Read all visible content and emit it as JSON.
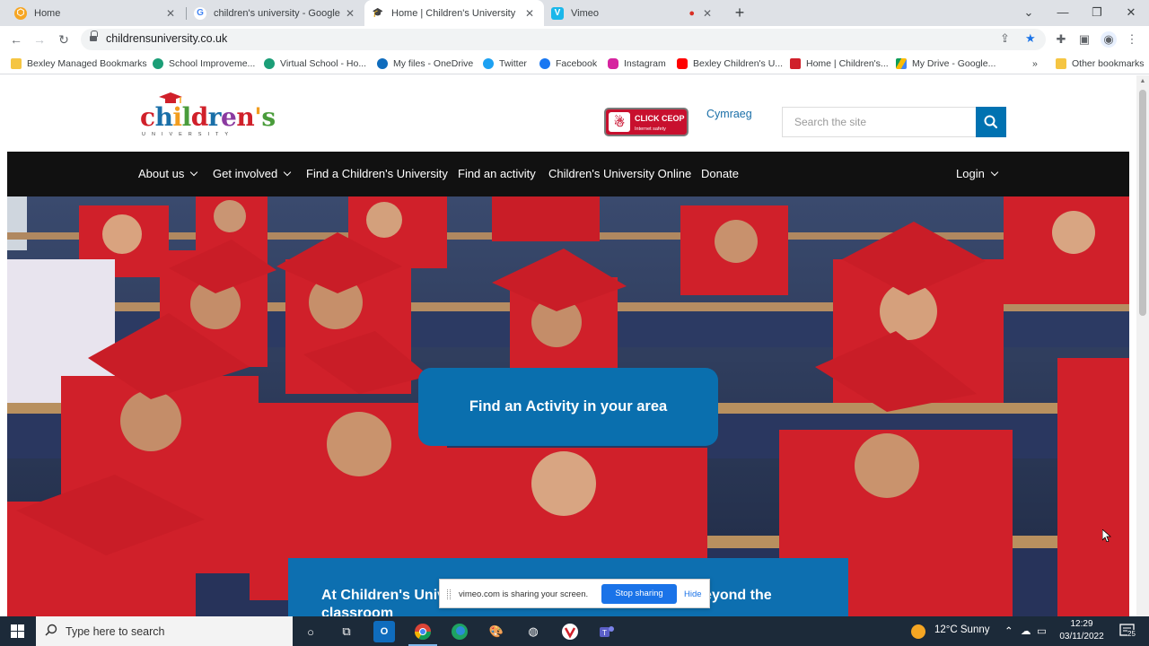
{
  "browser": {
    "tabs": [
      {
        "title": "Home",
        "icon": "home-favicon"
      },
      {
        "title": "children's university - Google Se",
        "icon": "google-favicon"
      },
      {
        "title": "Home | Children's University",
        "icon": "childrens-university-favicon"
      },
      {
        "title": "Vimeo",
        "icon": "vimeo-favicon"
      }
    ],
    "recording_indicator": "●",
    "url": "childrensuniversity.co.uk",
    "bookmarks": [
      "Bexley Managed Bookmarks",
      "School Improveme...",
      "Virtual School - Ho...",
      "My files - OneDrive",
      "Twitter",
      "Facebook",
      "Instagram",
      "Bexley Children's U...",
      "Home | Children's...",
      "My Drive - Google..."
    ],
    "more_bookmarks": "»",
    "other_bookmarks": "Other bookmarks"
  },
  "site": {
    "logo_text": "children's",
    "logo_sub": "UNIVERSITY",
    "ceop": {
      "line1": "CLICK CEOP",
      "line2": "Internet safety"
    },
    "cymraeg": "Cymraeg",
    "search_placeholder": "Search the site",
    "nav": {
      "about": "About us",
      "get_involved": "Get involved",
      "find_cu": "Find a Children's University",
      "find_activity": "Find an activity",
      "cu_online": "Children's University Online",
      "donate": "Donate",
      "login": "Login"
    },
    "hero_button": "Find an Activity in your area",
    "panel_text": "At Children's Univ",
    "panel_text_right": "eyond the",
    "panel_text_line2": "classroom"
  },
  "share_bar": {
    "text": "vimeo.com is sharing your screen.",
    "stop": "Stop sharing",
    "hide": "Hide"
  },
  "taskbar": {
    "search_placeholder": "Type here to search",
    "weather": "12°C  Sunny",
    "time": "12:29",
    "date": "03/11/2022",
    "notifications": "25"
  },
  "colors": {
    "accent_blue": "#0072b1",
    "nav_bg": "#111111",
    "gown_red": "#d0202a"
  }
}
